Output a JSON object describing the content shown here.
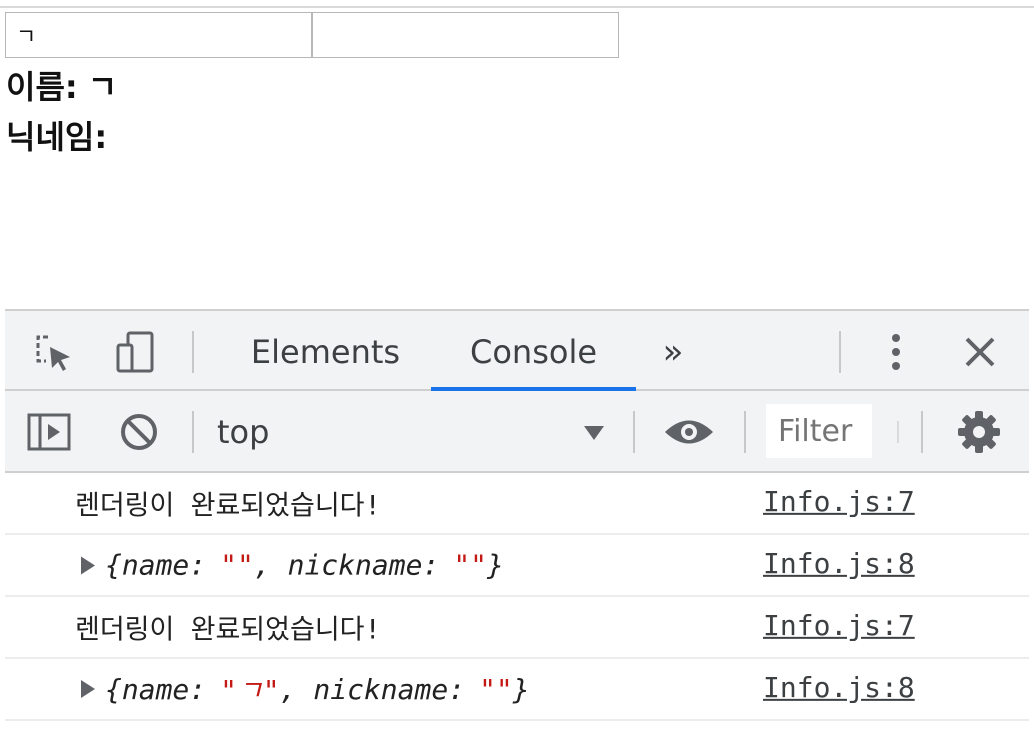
{
  "app": {
    "name_input_value": "ㄱ",
    "nickname_input_value": "",
    "name_label": "이름:",
    "name_value": "ㄱ",
    "nickname_label": "닉네임:",
    "nickname_value": ""
  },
  "devtools": {
    "tabs": [
      "Elements",
      "Console"
    ],
    "active_tab": "Console",
    "more_tabs_glyph": "»",
    "context": "top",
    "filter_placeholder": "Filter",
    "accent_color": "#1a73e8",
    "icons": [
      "inspect-element-icon",
      "device-toolbar-icon",
      "more-tabs-icon",
      "kebab-menu-icon",
      "close-icon",
      "sidebar-toggle-icon",
      "clear-console-icon",
      "dropdown-arrow-icon",
      "eye-icon",
      "gear-icon"
    ]
  },
  "console": {
    "messages": [
      {
        "text": "렌더링이 완료되었습니다!",
        "source": "Info.js:7"
      },
      {
        "object": {
          "name": "\"\"",
          "nickname": "\"\""
        },
        "source": "Info.js:8"
      },
      {
        "text": "렌더링이 완료되었습니다!",
        "source": "Info.js:7"
      },
      {
        "object": {
          "name": "\"ㄱ\"",
          "nickname": "\"\""
        },
        "source": "Info.js:8"
      }
    ],
    "string_color": "#c41a16"
  }
}
